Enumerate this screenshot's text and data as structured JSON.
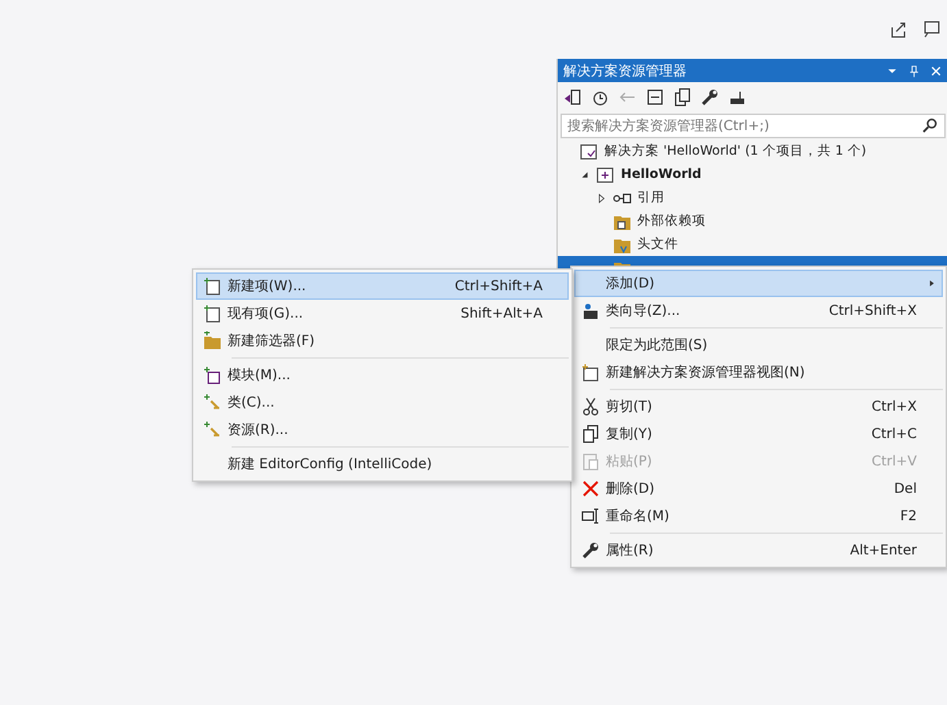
{
  "explorer": {
    "title": "解决方案资源管理器",
    "search": {
      "placeholder": "搜索解决方案资源管理器(Ctrl+;)"
    },
    "tree": [
      {
        "label": "解决方案 'HelloWorld' (1 个项目，共 1 个)",
        "bold": false,
        "selected": false,
        "children": [
          {
            "label": "HelloWorld",
            "bold": true,
            "selected": false,
            "expanded": true,
            "children": [
              {
                "label": "引用",
                "bold": false,
                "selected": false,
                "expanded": false
              },
              {
                "label": "外部依赖项",
                "bold": false,
                "selected": false
              },
              {
                "label": "头文件",
                "bold": false,
                "selected": false
              },
              {
                "bold": false,
                "selected": true
              }
            ]
          }
        ]
      }
    ]
  },
  "context_menu": [
    {
      "kind": "item",
      "label": "添加(D)",
      "submenu": true,
      "selected": true,
      "disabled": false
    },
    {
      "kind": "item",
      "label": "类向导(Z)...",
      "shortcut": "Ctrl+Shift+X",
      "submenu": false,
      "selected": false,
      "disabled": false
    },
    {
      "kind": "separator"
    },
    {
      "kind": "item",
      "label": "限定为此范围(S)",
      "submenu": false,
      "selected": false,
      "disabled": false
    },
    {
      "kind": "item",
      "label": "新建解决方案资源管理器视图(N)",
      "submenu": false,
      "selected": false,
      "disabled": false
    },
    {
      "kind": "separator"
    },
    {
      "kind": "item",
      "label": "剪切(T)",
      "shortcut": "Ctrl+X",
      "submenu": false,
      "selected": false,
      "disabled": false
    },
    {
      "kind": "item",
      "label": "复制(Y)",
      "shortcut": "Ctrl+C",
      "submenu": false,
      "selected": false,
      "disabled": false
    },
    {
      "kind": "item",
      "label": "粘贴(P)",
      "shortcut": "Ctrl+V",
      "submenu": false,
      "selected": false,
      "disabled": true
    },
    {
      "kind": "item",
      "label": "删除(D)",
      "shortcut": "Del",
      "submenu": false,
      "selected": false,
      "disabled": false
    },
    {
      "kind": "item",
      "label": "重命名(M)",
      "shortcut": "F2",
      "submenu": false,
      "selected": false,
      "disabled": false
    },
    {
      "kind": "separator"
    },
    {
      "kind": "item",
      "label": "属性(R)",
      "shortcut": "Alt+Enter",
      "submenu": false,
      "selected": false,
      "disabled": false
    }
  ],
  "add_submenu": [
    {
      "kind": "item",
      "label": "新建项(W)...",
      "shortcut": "Ctrl+Shift+A",
      "selected": true
    },
    {
      "kind": "item",
      "label": "现有项(G)...",
      "shortcut": "Shift+Alt+A",
      "selected": false
    },
    {
      "kind": "item",
      "label": "新建筛选器(F)",
      "selected": false
    },
    {
      "kind": "separator"
    },
    {
      "kind": "item",
      "label": "模块(M)...",
      "selected": false
    },
    {
      "kind": "item",
      "label": "类(C)...",
      "selected": false
    },
    {
      "kind": "item",
      "label": "资源(R)...",
      "selected": false
    },
    {
      "kind": "separator"
    },
    {
      "kind": "item",
      "label": "新建 EditorConfig (IntelliCode)",
      "selected": false
    }
  ]
}
